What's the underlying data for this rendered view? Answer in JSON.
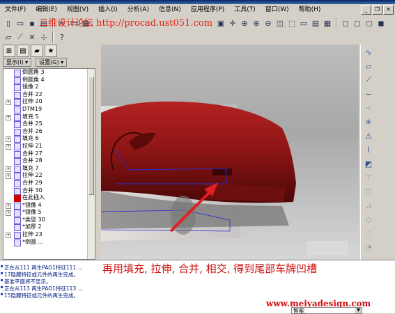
{
  "menu": [
    "文件(F)",
    "编辑(E)",
    "视图(V)",
    "插入(I)",
    "分析(A)",
    "信息(N)",
    "应用程序(P)",
    "工具(T)",
    "窗口(W)",
    "帮助(H)"
  ],
  "watermark": "三维设计论坛 http://procad.ust051.com",
  "nav": {
    "show_label": "显示(I)",
    "settings_label": "设置(G)"
  },
  "tree": [
    {
      "label": "倒圆角 3",
      "expand": ""
    },
    {
      "label": "倒圆角 4",
      "expand": ""
    },
    {
      "label": "镜像 2",
      "expand": ""
    },
    {
      "label": "合并 22",
      "expand": ""
    },
    {
      "label": "拉伸 20",
      "expand": "+"
    },
    {
      "label": "DTM19",
      "expand": ""
    },
    {
      "label": "填充 5",
      "expand": "+"
    },
    {
      "label": "合并 25",
      "expand": ""
    },
    {
      "label": "合并 26",
      "expand": ""
    },
    {
      "label": "填充 6",
      "expand": "+"
    },
    {
      "label": "拉伸 21",
      "expand": "+"
    },
    {
      "label": "合并 27",
      "expand": ""
    },
    {
      "label": "合并 28",
      "expand": ""
    },
    {
      "label": "填充 7",
      "expand": "+"
    },
    {
      "label": "拉伸 22",
      "expand": "+"
    },
    {
      "label": "合并 29",
      "expand": ""
    },
    {
      "label": "合并 30",
      "expand": ""
    },
    {
      "label": "在此插入",
      "expand": "",
      "insert": true
    },
    {
      "label": "*镜像 4",
      "expand": "+"
    },
    {
      "label": "*镜像 5",
      "expand": "+"
    },
    {
      "label": "*类型 30",
      "expand": ""
    },
    {
      "label": "*加厚 2",
      "expand": ""
    },
    {
      "label": "拉伸 23",
      "expand": "+"
    },
    {
      "label": "*倒圆 ...",
      "expand": ""
    }
  ],
  "messages": [
    "正在从111 再生PAO1特征111 ...",
    "17隐藏特征或元件的再生完成。",
    "基准平面将不显示。",
    "正在从113 再生PAO1特征113 ...",
    "15隐藏特征或元件的再生完成。"
  ],
  "caption": "再用填充, 拉伸, 合并, 相交, 得到尾部车牌凹槽",
  "site": "www.meiyadesign.com",
  "filter_select": "智能",
  "colors": {
    "car_body": "#8b1414",
    "caption": "#d01010",
    "arrow": "#e02020"
  }
}
